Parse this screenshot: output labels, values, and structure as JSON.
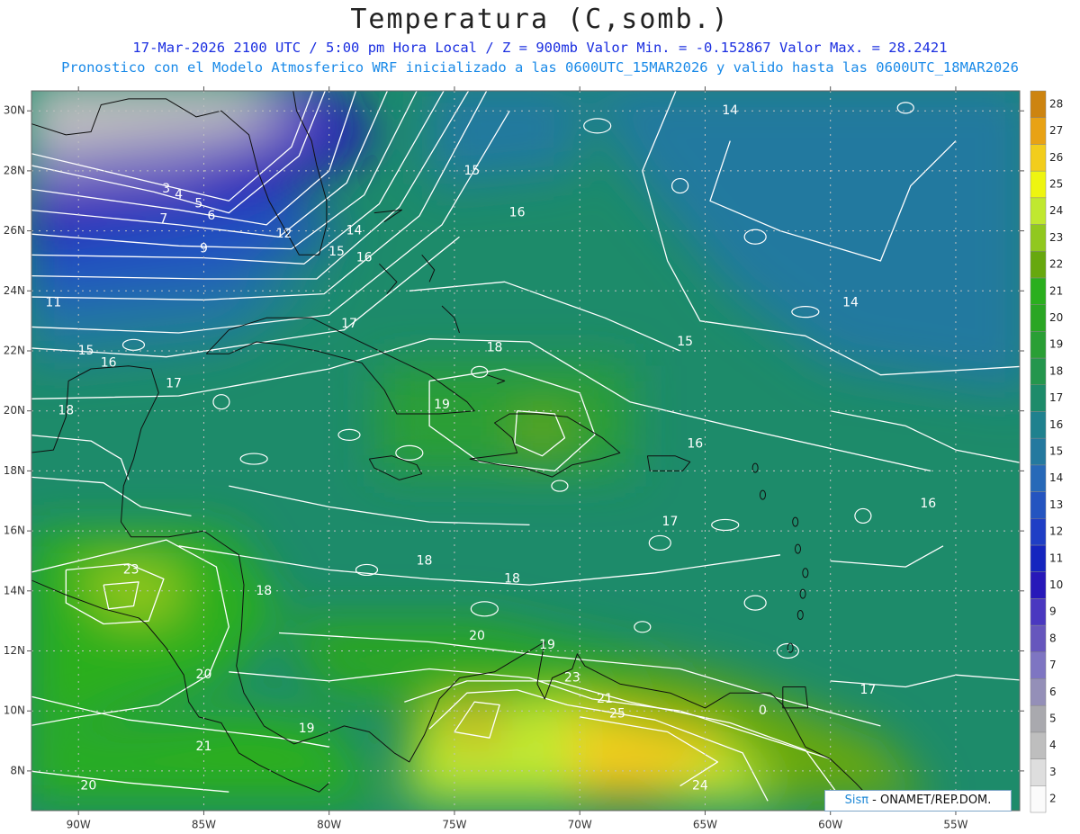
{
  "header": {
    "title": "Temperatura (C,somb.)",
    "subtitle1": "17-Mar-2026  2100 UTC / 5:00 pm Hora Local / Z = 900mb  Valor Min. = -0.152867  Valor Max. = 28.2421",
    "subtitle2": "Pronostico con el Modelo Atmosferico WRF inicializado a las 0600UTC_15MAR2026 y valido hasta las  0600UTC_18MAR2026"
  },
  "map": {
    "lon_labels": [
      "90W",
      "85W",
      "80W",
      "75W",
      "70W",
      "65W",
      "60W",
      "55W"
    ],
    "lat_labels": [
      "8N",
      "10N",
      "12N",
      "14N",
      "16N",
      "18N",
      "20N",
      "22N",
      "24N",
      "26N",
      "28N",
      "30N"
    ],
    "contour_labels": [
      {
        "text": "14",
        "lon": -64.0,
        "lat": 30.0
      },
      {
        "text": "15",
        "lon": -74.3,
        "lat": 28.0
      },
      {
        "text": "3",
        "lon": -86.5,
        "lat": 27.4
      },
      {
        "text": "4",
        "lon": -86.0,
        "lat": 27.2
      },
      {
        "text": "5",
        "lon": -85.2,
        "lat": 26.9
      },
      {
        "text": "6",
        "lon": -84.7,
        "lat": 26.5
      },
      {
        "text": "7",
        "lon": -86.6,
        "lat": 26.4
      },
      {
        "text": "16",
        "lon": -72.5,
        "lat": 26.6
      },
      {
        "text": "12",
        "lon": -81.8,
        "lat": 25.9
      },
      {
        "text": "14",
        "lon": -79.0,
        "lat": 26.0
      },
      {
        "text": "9",
        "lon": -85.0,
        "lat": 25.4
      },
      {
        "text": "15",
        "lon": -79.7,
        "lat": 25.3
      },
      {
        "text": "16",
        "lon": -78.6,
        "lat": 25.1
      },
      {
        "text": "11",
        "lon": -91.0,
        "lat": 23.6
      },
      {
        "text": "14",
        "lon": -59.2,
        "lat": 23.6
      },
      {
        "text": "17",
        "lon": -79.2,
        "lat": 22.9
      },
      {
        "text": "15",
        "lon": -65.8,
        "lat": 22.3
      },
      {
        "text": "18",
        "lon": -73.4,
        "lat": 22.1
      },
      {
        "text": "15",
        "lon": -89.7,
        "lat": 22.0
      },
      {
        "text": "16",
        "lon": -88.8,
        "lat": 21.6
      },
      {
        "text": "17",
        "lon": -86.2,
        "lat": 20.9
      },
      {
        "text": "19",
        "lon": -75.5,
        "lat": 20.2
      },
      {
        "text": "18",
        "lon": -90.5,
        "lat": 20.0
      },
      {
        "text": "16",
        "lon": -65.4,
        "lat": 18.9
      },
      {
        "text": "16",
        "lon": -56.1,
        "lat": 16.9
      },
      {
        "text": "17",
        "lon": -66.4,
        "lat": 16.3
      },
      {
        "text": "18",
        "lon": -76.2,
        "lat": 15.0
      },
      {
        "text": "23",
        "lon": -87.9,
        "lat": 14.7
      },
      {
        "text": "18",
        "lon": -72.7,
        "lat": 14.4
      },
      {
        "text": "18",
        "lon": -82.6,
        "lat": 14.0
      },
      {
        "text": "20",
        "lon": -74.1,
        "lat": 12.5
      },
      {
        "text": "19",
        "lon": -71.3,
        "lat": 12.2
      },
      {
        "text": "20",
        "lon": -85.0,
        "lat": 11.2
      },
      {
        "text": "23",
        "lon": -70.3,
        "lat": 11.1
      },
      {
        "text": "17",
        "lon": -58.5,
        "lat": 10.7
      },
      {
        "text": "21",
        "lon": -69.0,
        "lat": 10.4
      },
      {
        "text": "25",
        "lon": -68.5,
        "lat": 9.9
      },
      {
        "text": "0",
        "lon": -62.7,
        "lat": 10.0
      },
      {
        "text": "19",
        "lon": -80.9,
        "lat": 9.4
      },
      {
        "text": "21",
        "lon": -85.0,
        "lat": 8.8
      },
      {
        "text": "20",
        "lon": -89.6,
        "lat": 7.5
      },
      {
        "text": "24",
        "lon": -65.2,
        "lat": 7.5
      }
    ]
  },
  "colorbar": {
    "levels": [
      "2",
      "3",
      "4",
      "5",
      "6",
      "7",
      "8",
      "9",
      "10",
      "11",
      "12",
      "13",
      "14",
      "15",
      "16",
      "17",
      "18",
      "19",
      "20",
      "21",
      "22",
      "23",
      "24",
      "25",
      "26",
      "27",
      "28"
    ],
    "colors": [
      "#fbfbfb",
      "#dedede",
      "#bebebe",
      "#a9a9ae",
      "#948fb8",
      "#7e75c2",
      "#6656bd",
      "#4a38c0",
      "#2718b9",
      "#1525bf",
      "#1f3ec5",
      "#2454c0",
      "#2769b8",
      "#24799f",
      "#1f818e",
      "#1d8b6a",
      "#24964d",
      "#2a9f35",
      "#2aa624",
      "#2aaf1e",
      "#67a80e",
      "#91c81f",
      "#c0e830",
      "#eef510",
      "#f2cd1c",
      "#e8a215",
      "#cd8410"
    ]
  },
  "credit": {
    "logo": "Sisπ",
    "dash": " - ",
    "text": " ONAMET/REP.DOM."
  }
}
